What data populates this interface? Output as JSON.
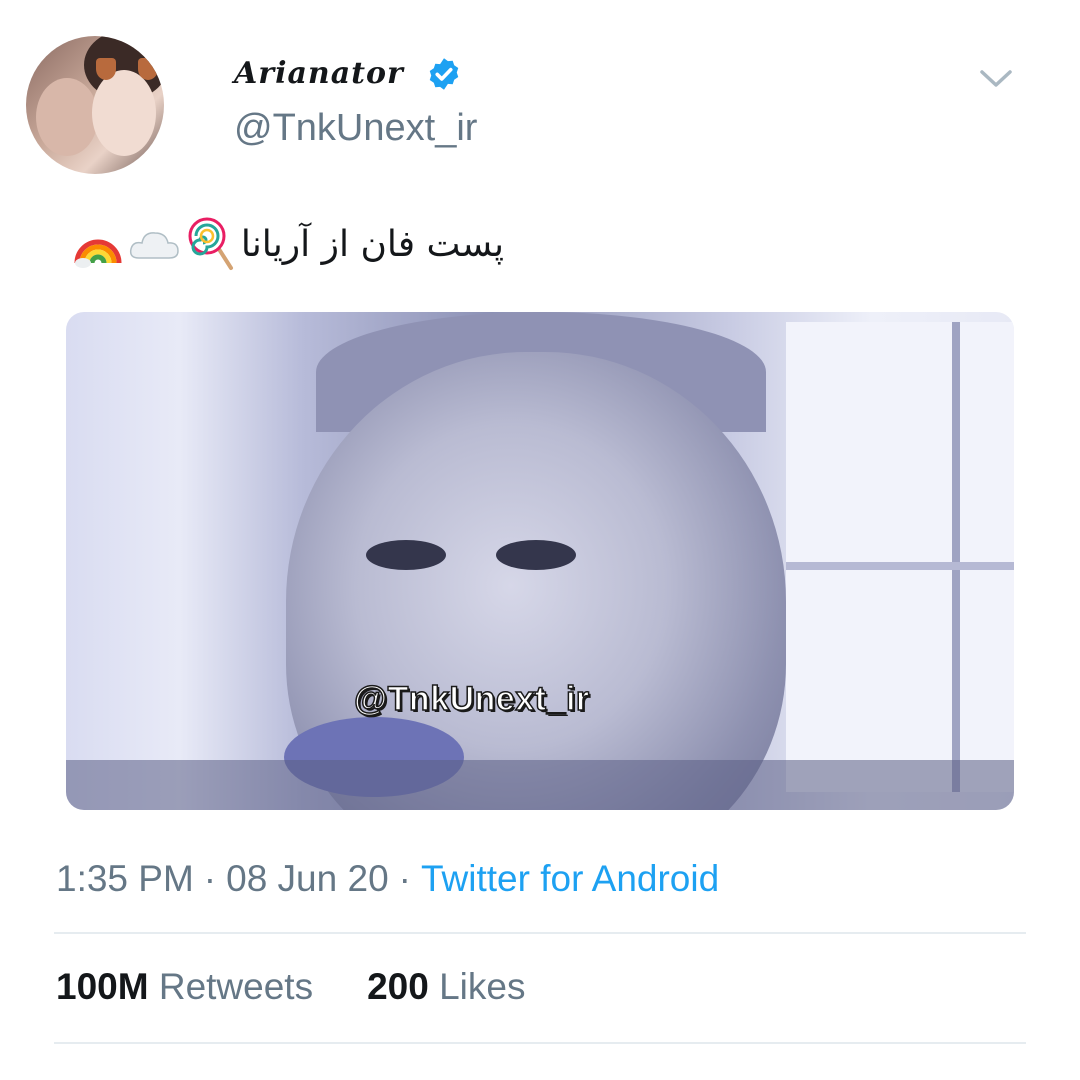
{
  "tweet": {
    "display_name": "Arianator",
    "handle": "@TnkUnext_ir",
    "text": "پست فان از آریانا",
    "emojis": [
      "lollipop",
      "cloud",
      "rainbow"
    ],
    "media_watermark": "@TnkUnext_ir",
    "time": "1:35 PM",
    "date": "08 Jun 20",
    "source": "Twitter for Android",
    "separator": "·"
  },
  "stats": {
    "retweets_count": "100M",
    "retweets_label": "Retweets",
    "likes_count": "200",
    "likes_label": "Likes"
  },
  "icons": {
    "verified": "verified-badge-icon",
    "chevron": "chevron-down-icon"
  },
  "colors": {
    "accent": "#1da1f2",
    "secondary_text": "#657786",
    "primary_text": "#14171a",
    "divider": "#e6ecf0"
  }
}
